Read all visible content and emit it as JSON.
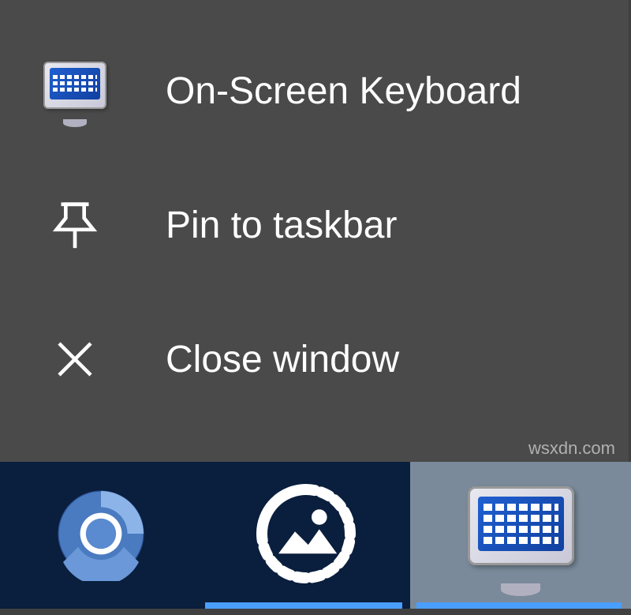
{
  "contextMenu": {
    "items": [
      {
        "label": "On-Screen Keyboard",
        "icon": "osk-icon"
      },
      {
        "label": "Pin to taskbar",
        "icon": "pin-icon"
      },
      {
        "label": "Close window",
        "icon": "close-icon"
      }
    ]
  },
  "taskbar": {
    "items": [
      {
        "name": "chromium",
        "icon": "chromium-icon"
      },
      {
        "name": "photos",
        "icon": "photos-icon"
      },
      {
        "name": "on-screen-keyboard",
        "icon": "osk-icon",
        "active": true
      }
    ]
  },
  "watermark": "wsxdn.com"
}
